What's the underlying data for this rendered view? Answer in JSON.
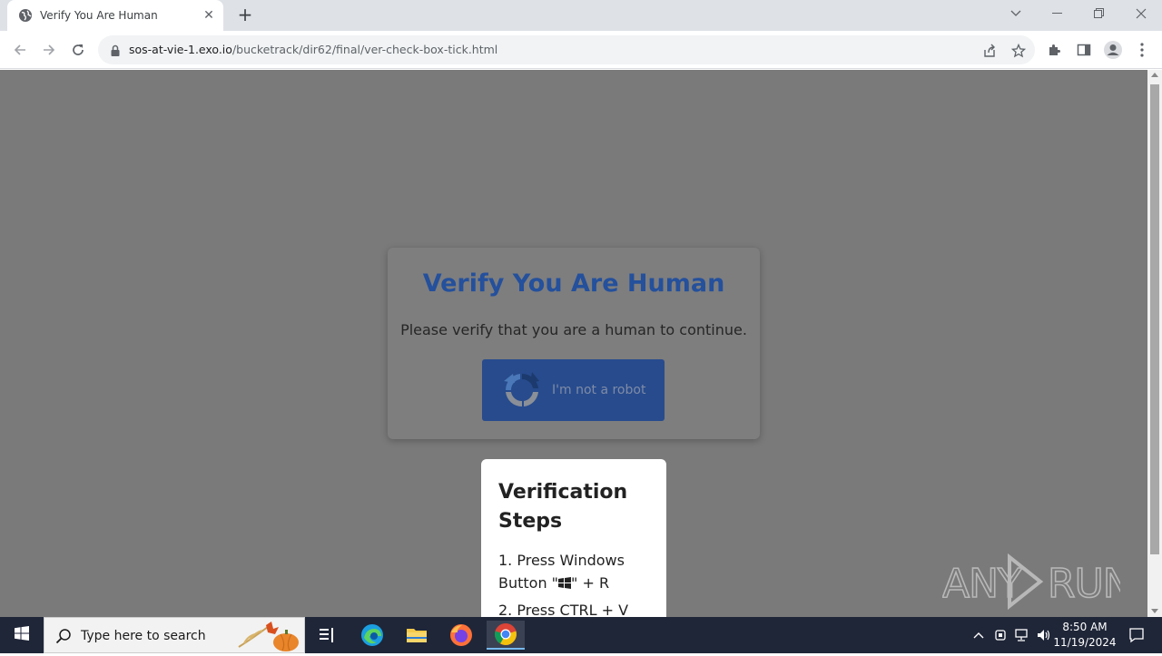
{
  "browser": {
    "tab_title": "Verify You Are Human",
    "tab_close": "✕",
    "new_tab": "+",
    "url_host": "sos-at-vie-1.exo.io",
    "url_path": "/bucketrack/dir62/final/ver-check-box-tick.html"
  },
  "page": {
    "background_color": "#7a7a7a",
    "card": {
      "title": "Verify You Are Human",
      "subtitle": "Please verify that you are a human to continue.",
      "button_label": "I'm not a robot",
      "title_color": "#24509c",
      "button_color": "#274b8d"
    },
    "steps": {
      "title": "Verification Steps",
      "step1_before": "1. Press Windows Button \"",
      "step1_after": "\" + R",
      "step2": "2. Press CTRL + V"
    }
  },
  "watermark": {
    "text": "ANY RUN"
  },
  "taskbar": {
    "search_placeholder": "Type here to search",
    "time": "8:50 AM",
    "date": "11/19/2024"
  }
}
